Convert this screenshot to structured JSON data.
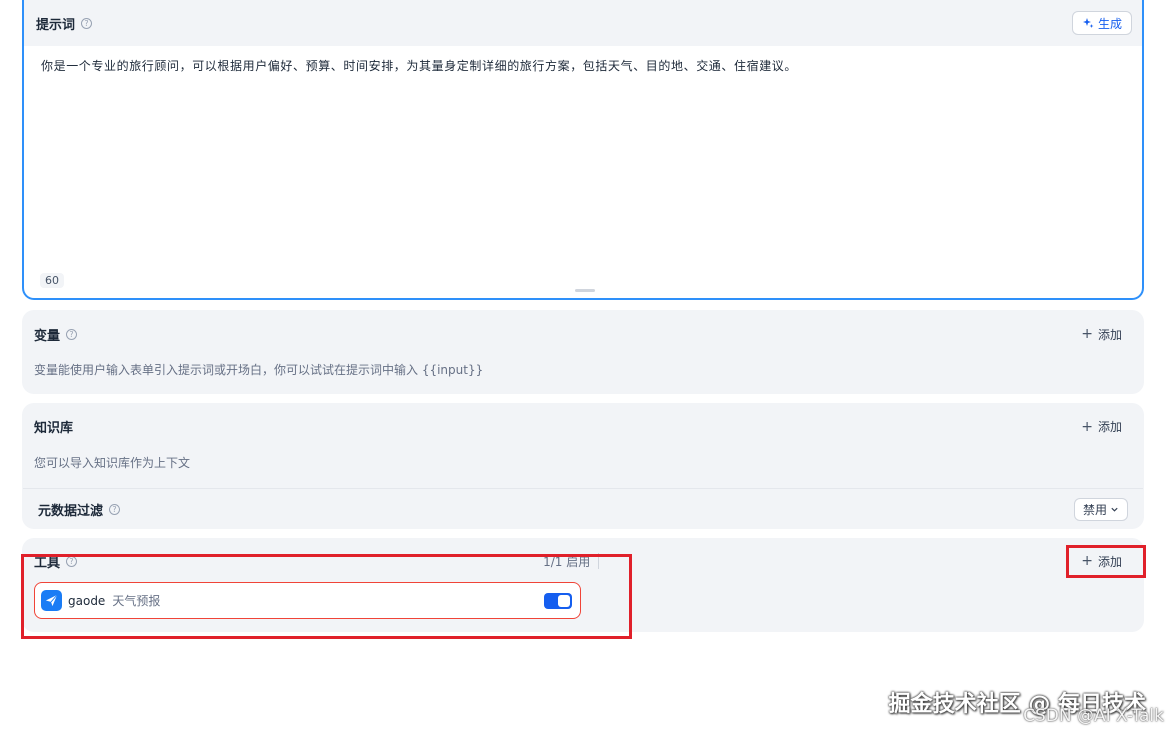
{
  "prompt": {
    "title": "提示词",
    "generate_label": "生成",
    "text": "你是一个专业的旅行顾问，可以根据用户偏好、预算、时间安排，为其量身定制详细的旅行方案，包括天气、目的地、交通、住宿建议。",
    "char_count": "60"
  },
  "variables": {
    "title": "变量",
    "add_label": "添加",
    "description": "变量能使用户输入表单引入提示词或开场白，你可以试试在提示词中输入 {{input}}"
  },
  "knowledge": {
    "title": "知识库",
    "add_label": "添加",
    "description": "您可以导入知识库作为上下文",
    "metadata_filter_label": "元数据过滤",
    "metadata_filter_value": "禁用"
  },
  "tools": {
    "title": "工具",
    "enabled_count": "1/1 启用",
    "add_label": "添加",
    "items": [
      {
        "name": "gaode",
        "subtitle": "天气预报",
        "enabled": true,
        "logo": "gaode-logo-icon"
      }
    ]
  },
  "watermark": {
    "line1": "掘金技术社区 @ 每日技术",
    "line2": "CSDN @AI X-Talk"
  },
  "colors": {
    "accent": "#155eef",
    "border_focus": "#2e90fa",
    "highlight": "#e0202a",
    "panel_bg": "#f2f4f7"
  }
}
